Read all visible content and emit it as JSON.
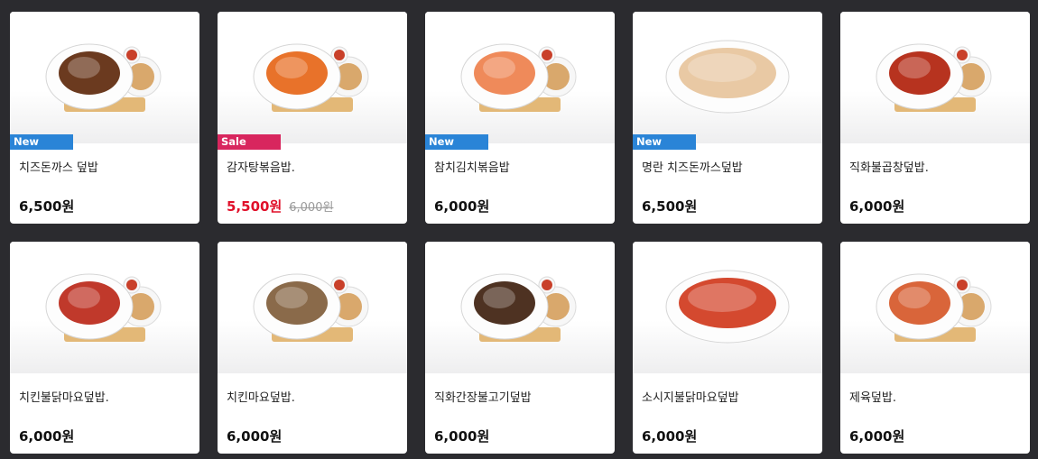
{
  "products": [
    {
      "name": "치즈돈까스 덮밥",
      "price": "6,500원",
      "original_price": "",
      "badge": "New",
      "dish_color": "#6b3a1f"
    },
    {
      "name": "감자탕볶음밥.",
      "price": "5,500원",
      "original_price": "6,000원",
      "badge": "Sale",
      "dish_color": "#e8722a"
    },
    {
      "name": "참치김치볶음밥",
      "price": "6,000원",
      "original_price": "",
      "badge": "New",
      "dish_color": "#ef8a5a"
    },
    {
      "name": "명란 치즈돈까스덮밥",
      "price": "6,500원",
      "original_price": "",
      "badge": "New",
      "dish_color": "#e9c9a4"
    },
    {
      "name": "직화불곱창덮밥.",
      "price": "6,000원",
      "original_price": "",
      "badge": "",
      "dish_color": "#b7331f"
    },
    {
      "name": "치킨불닭마요덮밥.",
      "price": "6,000원",
      "original_price": "",
      "badge": "",
      "dish_color": "#c0392b"
    },
    {
      "name": "치킨마요덮밥.",
      "price": "6,000원",
      "original_price": "",
      "badge": "",
      "dish_color": "#8a6a4a"
    },
    {
      "name": "직화간장불고기덮밥",
      "price": "6,000원",
      "original_price": "",
      "badge": "",
      "dish_color": "#4e3222"
    },
    {
      "name": "소시지불닭마요덮밥",
      "price": "6,000원",
      "original_price": "",
      "badge": "",
      "dish_color": "#d4492f"
    },
    {
      "name": "제육덮밥.",
      "price": "6,000원",
      "original_price": "",
      "badge": "",
      "dish_color": "#d9653a"
    }
  ]
}
